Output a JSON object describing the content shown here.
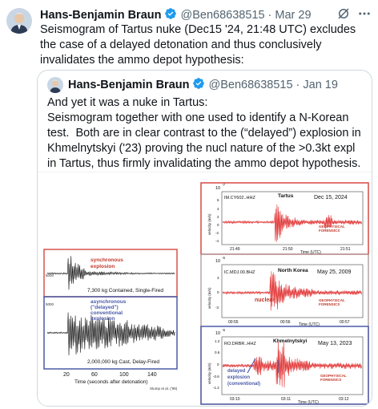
{
  "tweet": {
    "author": "Hans-Benjamin Braun",
    "handle": "@Ben68638515",
    "separator": "·",
    "time": "Mar 29",
    "text": "Seismogram of Tartus nuke (Dec15 '24, 21:48 UTC) excludes the case of a delayed detonation and thus conclusively invalidates the ammo depot hypothesis:"
  },
  "quoted": {
    "author": "Hans-Benjamin Braun",
    "handle": "@Ben68638515",
    "separator": "·",
    "time": "Jan 19",
    "text": "And yet it was a nuke in Tartus:\nSeismogram together with one used to identify a N-Korean test.  Both are in clear contrast to the (“delayed”) explosion in Khmelnytskyi ('23) proving the nucl nature of the >0.3kt expl in Tartus, thus firmly invalidating the ammo depot hypothesis."
  },
  "icons": [
    "verified-badge-icon",
    "grok-icon",
    "more-icon"
  ],
  "colors": {
    "verified": "#1d9bf0",
    "red_box": "#d9534f",
    "blue_box": "#4a5aa8",
    "seismo_red": "#e03030"
  },
  "left_figure": {
    "label_sync_1": "synchronous",
    "label_sync_2": "explosion",
    "caption_sync": "7,300 kg Contained, Single-Fired",
    "label_async_1": "asynchronous",
    "label_async_2": "(\"delayed\")",
    "label_async_3": "conventional",
    "label_async_4": "explosion",
    "caption_async": "2,000,000 kg Cast, Delay-Fired",
    "y_tick_top": "5000",
    "y_tick_mid": "5000",
    "x_ticks": [
      "20",
      "60",
      "100",
      "140"
    ],
    "x_label": "Time (seconds after detonation)",
    "citation": "Stump et al. ('99)"
  },
  "panels": [
    {
      "exponent": "10",
      "exp_sup": "-7",
      "station": "IM.CY602..HHZ",
      "place": "Tartus",
      "date": "Dec 15, 2024",
      "ylabel": "velocity (m/s)",
      "y_ticks": [
        "6",
        "4",
        "2",
        "0",
        "-2",
        "-4"
      ],
      "x_ticks": [
        "21:49",
        "21:50",
        "21:51"
      ],
      "x_label": "Time (UTC)",
      "logo_1": "GEOPHYSICAL",
      "logo_2": "FORENSICS"
    },
    {
      "exponent": "10",
      "exp_sup": "-5",
      "station": "IC.MDJ.00.BHZ",
      "place": "North Korea",
      "date": "May 25, 2009",
      "ylabel": "velocity (m/s)",
      "y_ticks": [
        "3",
        "0",
        "-3"
      ],
      "annotation": "nuclear",
      "x_ticks": [
        "00:55",
        "00:56",
        "00:57"
      ],
      "x_label": "Time (UTC)",
      "logo_1": "GEOPHYSICAL",
      "logo_2": "FORENSICS"
    },
    {
      "exponent": "10",
      "exp_sup": "-5",
      "station": "RO.DRBR..HHZ",
      "place": "Khmelnytskyi",
      "date": "May 13, 2023",
      "ylabel": "velocity (m/s)",
      "y_ticks": [
        "1.2",
        "0.6",
        "0",
        "-0.6",
        "-1.2"
      ],
      "annotation_1": "delayed",
      "annotation_2": "explosion",
      "annotation_3": "(conventional)",
      "x_ticks": [
        "03:10",
        "03:11",
        "03:12"
      ],
      "x_label": "Time (UTC)",
      "logo_1": "GEOPHYSICAL",
      "logo_2": "FORENSICS"
    }
  ]
}
